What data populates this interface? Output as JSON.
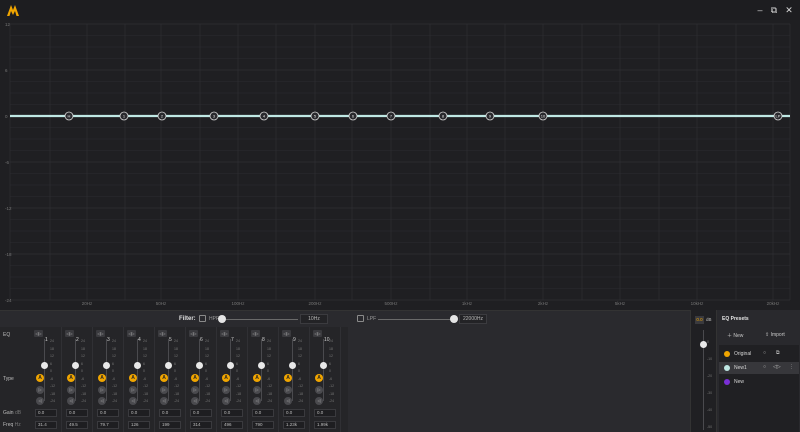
{
  "window": {
    "minimize_glyph": "–",
    "maximize_glyph": "⧉",
    "close_glyph": "✕"
  },
  "graph": {
    "y_ticks": [
      "12",
      "6",
      "0",
      "-6",
      "-12",
      "-18",
      "-24"
    ],
    "x_ticks": [
      "20Hz",
      "50Hz",
      "100Hz",
      "200Hz",
      "500Hz",
      "1kHz",
      "2kHz",
      "5kHz",
      "10kHz",
      "20kHz"
    ],
    "node_labels": [
      "H",
      "1",
      "2",
      "3",
      "4",
      "5",
      "6",
      "7",
      "8",
      "9",
      "10",
      "LP"
    ],
    "curve_color": "#bfe8e4"
  },
  "filter": {
    "label": "Filter:",
    "hpf_label": "HPF",
    "hpf_value": "10Hz",
    "lpf_label": "LPF",
    "lpf_value": "22000Hz"
  },
  "bands_panel": {
    "eq_label": "EQ",
    "type_label": "Type",
    "gain_label": "Gain",
    "gain_unit": "dB",
    "freq_label": "Freq",
    "freq_unit": "Hz",
    "scale": [
      "24",
      "18",
      "12",
      "6",
      "0",
      "-6",
      "-12",
      "-18",
      "-24"
    ],
    "type_active": "A",
    "bands": [
      {
        "num": "1",
        "gain": "0.0",
        "freq": "31.4"
      },
      {
        "num": "2",
        "gain": "0.0",
        "freq": "49.5"
      },
      {
        "num": "3",
        "gain": "0.0",
        "freq": "79.7"
      },
      {
        "num": "4",
        "gain": "0.0",
        "freq": "126"
      },
      {
        "num": "5",
        "gain": "0.0",
        "freq": "199"
      },
      {
        "num": "6",
        "gain": "0.0",
        "freq": "314"
      },
      {
        "num": "7",
        "gain": "0.0",
        "freq": "496"
      },
      {
        "num": "8",
        "gain": "0.0",
        "freq": "790"
      },
      {
        "num": "9",
        "gain": "0.0",
        "freq": "1.23k"
      },
      {
        "num": "10",
        "gain": "0.0",
        "freq": "1.99k"
      }
    ]
  },
  "master": {
    "value": "0.0",
    "unit": "dB",
    "scale": [
      "0",
      "-10",
      "-20",
      "-30",
      "-40",
      "-50"
    ]
  },
  "presets": {
    "title": "EQ Presets",
    "new_label": "New",
    "import_label": "Import",
    "items": [
      {
        "name": "Original",
        "color": "#f0a500",
        "active": false
      },
      {
        "name": "New1",
        "color": "#bfe8e4",
        "active": true
      },
      {
        "name": "New",
        "color": "#7a2fd6",
        "active": false
      }
    ]
  }
}
